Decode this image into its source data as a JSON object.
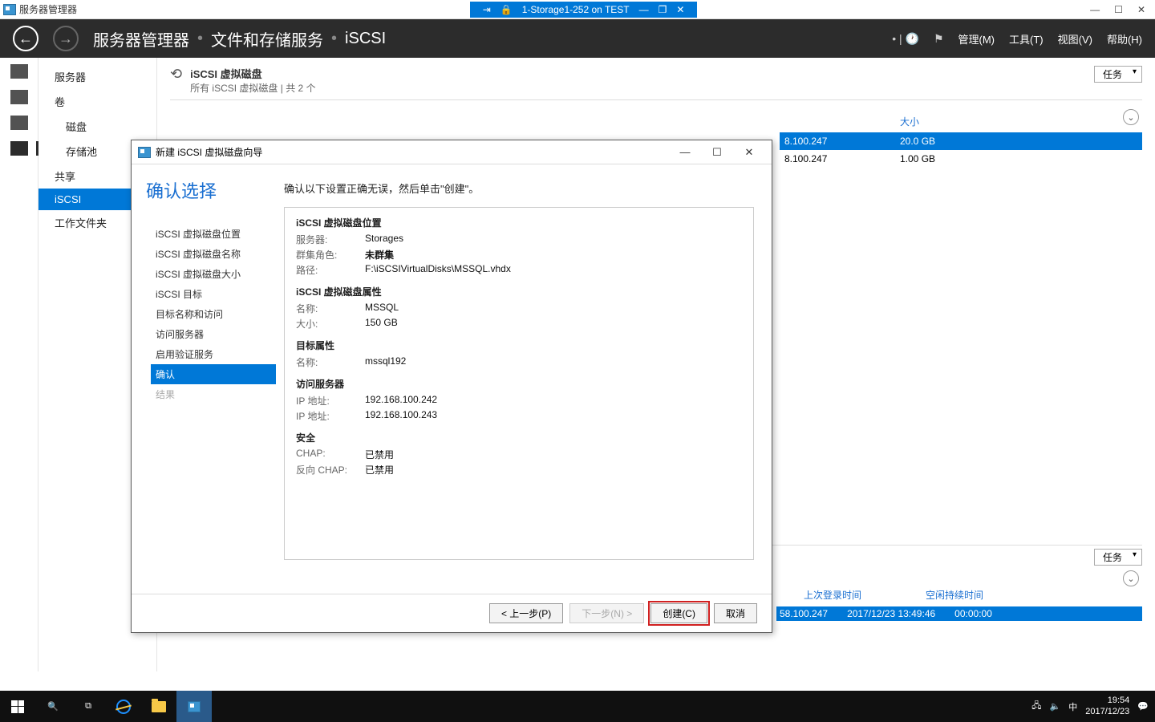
{
  "vm": {
    "app_title": "服务器管理器",
    "session": "1-Storage1-252 on TEST"
  },
  "sm": {
    "breadcrumb": {
      "root": "服务器管理器",
      "lvl1": "文件和存储服务",
      "lvl2": "iSCSI"
    },
    "menus": {
      "manage": "管理(M)",
      "tools": "工具(T)",
      "view": "视图(V)",
      "help": "帮助(H)"
    }
  },
  "nav": {
    "servers": "服务器",
    "volumes": "卷",
    "disks": "磁盘",
    "pools": "存储池",
    "shares": "共享",
    "iscsi": "iSCSI",
    "workfolders": "工作文件夹"
  },
  "panel": {
    "title": "iSCSI 虚拟磁盘",
    "subtitle": "所有 iSCSI 虚拟磁盘 | 共 2 个",
    "tasks": "任务",
    "col_size": "大小",
    "rows": [
      {
        "ip": "8.100.247",
        "size": "20.0 GB"
      },
      {
        "ip": "8.100.247",
        "size": "1.00 GB"
      }
    ]
  },
  "lower": {
    "tasks": "任务",
    "last_login": "上次登录时间",
    "idle": "空闲持续时间",
    "sess": {
      "ip": "58.100.247",
      "time": "2017/12/23 13:49:46",
      "idle": "00:00:00"
    }
  },
  "dialog": {
    "title": "新建 iSCSI 虚拟磁盘向导",
    "heading": "确认选择",
    "steps": {
      "loc": "iSCSI 虚拟磁盘位置",
      "name": "iSCSI 虚拟磁盘名称",
      "size": "iSCSI 虚拟磁盘大小",
      "target": "iSCSI 目标",
      "targetname": "目标名称和访问",
      "access": "访问服务器",
      "auth": "启用验证服务",
      "confirm": "确认",
      "result": "结果"
    },
    "instr": "确认以下设置正确无误，然后单击\"创建\"。",
    "sec_loc": "iSCSI 虚拟磁盘位置",
    "k_server": "服务器:",
    "v_server": "Storages",
    "k_cluster": "群集角色:",
    "v_cluster": "未群集",
    "k_path": "路径:",
    "v_path": "F:\\iSCSIVirtualDisks\\MSSQL.vhdx",
    "sec_attr": "iSCSI 虚拟磁盘属性",
    "k_name": "名称:",
    "v_name": "MSSQL",
    "k_size": "大小:",
    "v_size": "150 GB",
    "sec_target": "目标属性",
    "k_tname": "名称:",
    "v_tname": "mssql192",
    "sec_access": "访问服务器",
    "k_ip1": "IP 地址:",
    "v_ip1": "192.168.100.242",
    "k_ip2": "IP 地址:",
    "v_ip2": "192.168.100.243",
    "sec_security": "安全",
    "k_chap": "CHAP:",
    "v_chap": "已禁用",
    "k_rchap": "反向 CHAP:",
    "v_rchap": "已禁用",
    "btn_prev": "< 上一步(P)",
    "btn_next": "下一步(N) >",
    "btn_create": "创建(C)",
    "btn_cancel": "取消"
  },
  "taskbar": {
    "ime": "中",
    "time": "19:54",
    "date": "2017/12/23"
  }
}
